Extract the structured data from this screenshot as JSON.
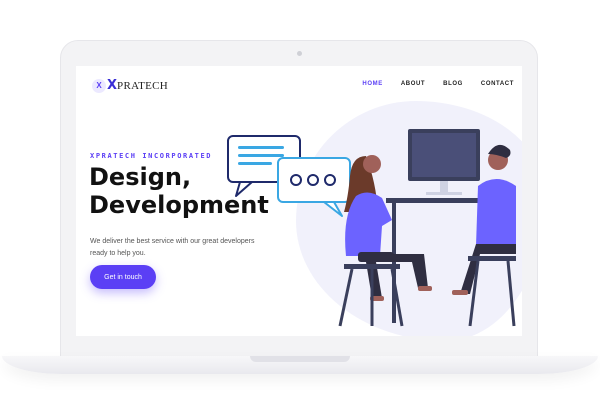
{
  "brand": {
    "logo_mark": "X",
    "logo_x": "X",
    "logo_text": "PRATECH"
  },
  "nav": {
    "items": [
      {
        "label": "HOME",
        "active": true
      },
      {
        "label": "ABOUT",
        "active": false
      },
      {
        "label": "BLOG",
        "active": false
      },
      {
        "label": "CONTACT",
        "active": false
      }
    ]
  },
  "hero": {
    "eyebrow": "XPRATECH INCORPORATED",
    "headline_line1": "Design,",
    "headline_line2": "Development",
    "subtext": "We deliver the best service with our great developers ready to help you.",
    "cta_label": "Get in touch"
  },
  "colors": {
    "accent": "#5b3ff5",
    "text": "#111111",
    "blob": "#f1f1fb"
  },
  "icons": [
    "chat-bubble-icon",
    "ellipsis-chat-icon",
    "monitor-icon"
  ]
}
